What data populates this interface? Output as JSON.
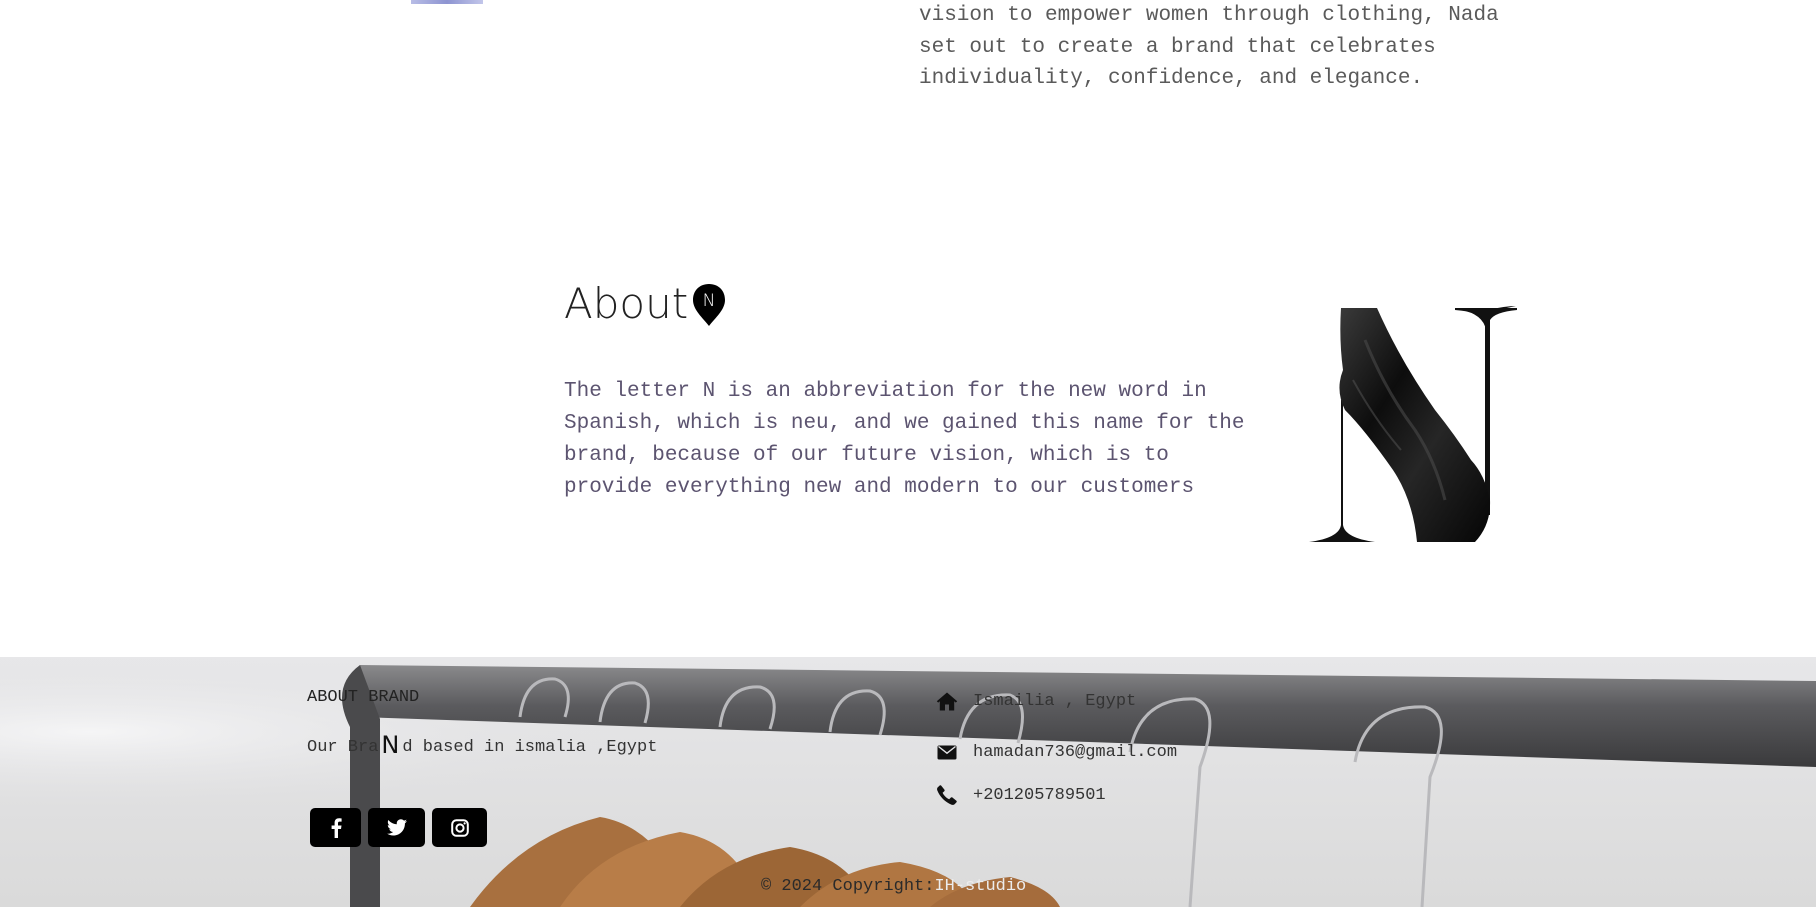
{
  "story": {
    "text": "vision to empower women through clothing, Nada set out to create a brand that celebrates individuality, confidence, and elegance."
  },
  "about": {
    "title": "About",
    "logo_letter": "N",
    "text": "The letter N is an abbreviation for the new word in Spanish, which is neu, and we gained this name for the brand, because of our future vision, which is to provide everything new and modern to our customers",
    "image_icon": "brand-n-letter-fabric"
  },
  "footer": {
    "about_heading": "ABOUT BRAND",
    "brand_line_before": "Our Bra",
    "brand_line_logo": "N",
    "brand_line_after": "d based in ismalia ,Egypt",
    "social": [
      {
        "name": "facebook-icon"
      },
      {
        "name": "twitter-icon"
      },
      {
        "name": "instagram-icon"
      }
    ],
    "contact": {
      "address": "Ismailia , Egypt",
      "email": "hamadan736@gmail.com",
      "phone": "+201205789501"
    },
    "copyright_prefix": "© 2024 Copyright:",
    "copyright_studio": "IH-studio",
    "background": "clothes-rack-with-hangers"
  }
}
